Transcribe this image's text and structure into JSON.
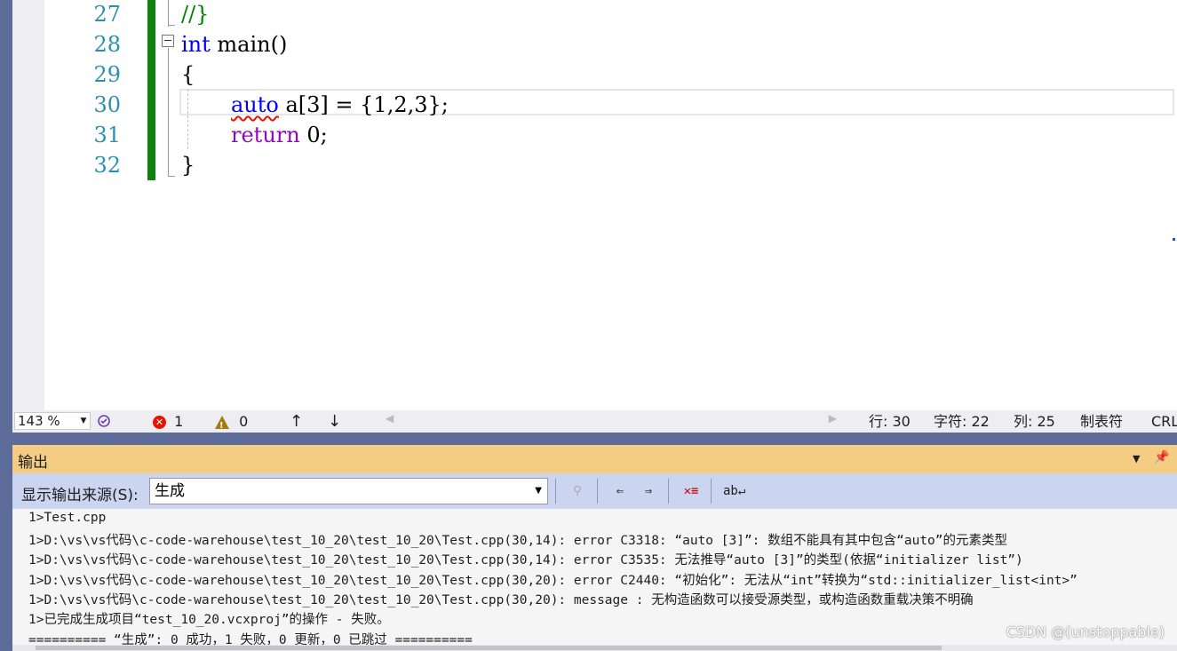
{
  "editor": {
    "lines": [
      {
        "num": "27",
        "code": "//}"
      },
      {
        "num": "28",
        "kw": "int",
        "rest": " main()"
      },
      {
        "num": "29",
        "code": "{"
      },
      {
        "num": "30",
        "squig": "auto",
        "rest": " a[3] = {1,2,3};"
      },
      {
        "num": "31",
        "kw": "return",
        "rest": " 0;"
      },
      {
        "num": "32",
        "code": "}"
      }
    ]
  },
  "status": {
    "zoom": "143 %",
    "errors": "1",
    "warnings": "0",
    "line": "行: 30",
    "char": "字符: 22",
    "col": "列: 25",
    "tabs": "制表符",
    "eol": "CRLF"
  },
  "output": {
    "title": "输出",
    "source_label": "显示输出来源(S):",
    "source_value": "生成",
    "lines": [
      "1>Test.cpp",
      "1>D:\\vs\\vs代码\\c-code-warehouse\\test_10_20\\test_10_20\\Test.cpp(30,14): error C3318: “auto [3]”: 数组不能具有其中包含“auto”的元素类型",
      "1>D:\\vs\\vs代码\\c-code-warehouse\\test_10_20\\test_10_20\\Test.cpp(30,14): error C3535: 无法推导“auto [3]”的类型(依据“initializer list”)",
      "1>D:\\vs\\vs代码\\c-code-warehouse\\test_10_20\\test_10_20\\Test.cpp(30,20): error C2440: “初始化”: 无法从“int”转换为“std::initializer_list<int>”",
      "1>D:\\vs\\vs代码\\c-code-warehouse\\test_10_20\\test_10_20\\Test.cpp(30,20): message : 无构造函数可以接受源类型，或构造函数重载决策不明确",
      "1>已完成生成项目“test_10_20.vcxproj”的操作 - 失败。",
      "========== “生成”: 0 成功，1 失败，0 更新，0 已跳过 =========="
    ]
  },
  "watermark": "CSDN @(unstoppable)"
}
